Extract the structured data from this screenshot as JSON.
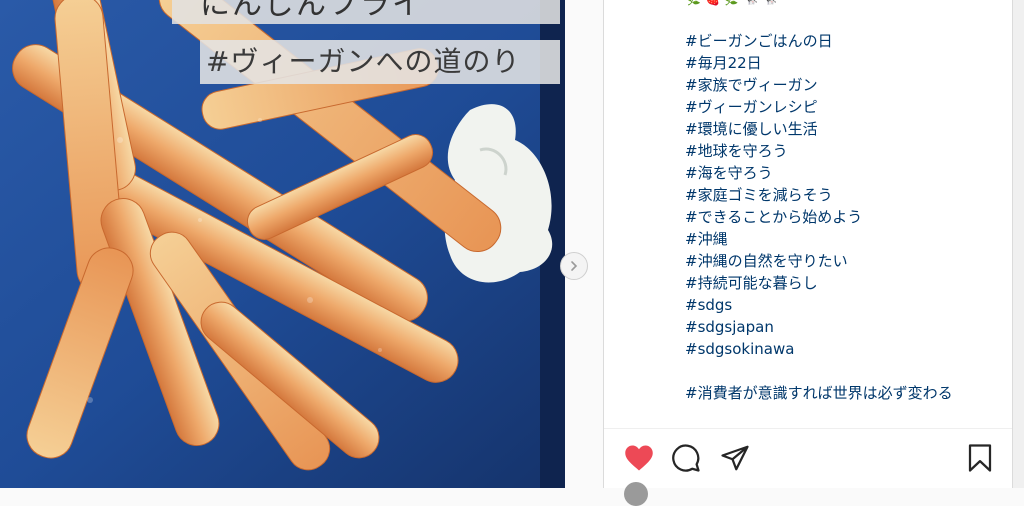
{
  "photo": {
    "caption_top": "にんじんフライ",
    "caption_hashtag": "#ヴィーガンへの道のり"
  },
  "carousel": {
    "next_icon": "chevron-right-icon"
  },
  "post": {
    "emoji_row": [
      "🌿",
      "🍓",
      "🌿",
      "🐄",
      "🐄"
    ],
    "hashtags": [
      "#ビーガンごはんの日",
      "#毎月22日",
      "#家族でヴィーガン",
      "#ヴィーガンレシピ",
      "#環境に優しい生活",
      "#地球を守ろう",
      "#海を守ろう",
      "#家庭ゴミを減らそう",
      "#できることから始めよう",
      "#沖縄",
      "#沖縄の自然を守りたい",
      "#持続可能な暮らし",
      "#sdgs",
      "#sdgsjapan",
      "#sdgsokinawa"
    ],
    "closing_tag": "#消費者が意識すれば世界は必ず変わる"
  },
  "actions": {
    "like_icon": "heart-icon",
    "comment_icon": "comment-icon",
    "share_icon": "send-icon",
    "save_icon": "bookmark-icon",
    "like_color": "#ed4956"
  }
}
